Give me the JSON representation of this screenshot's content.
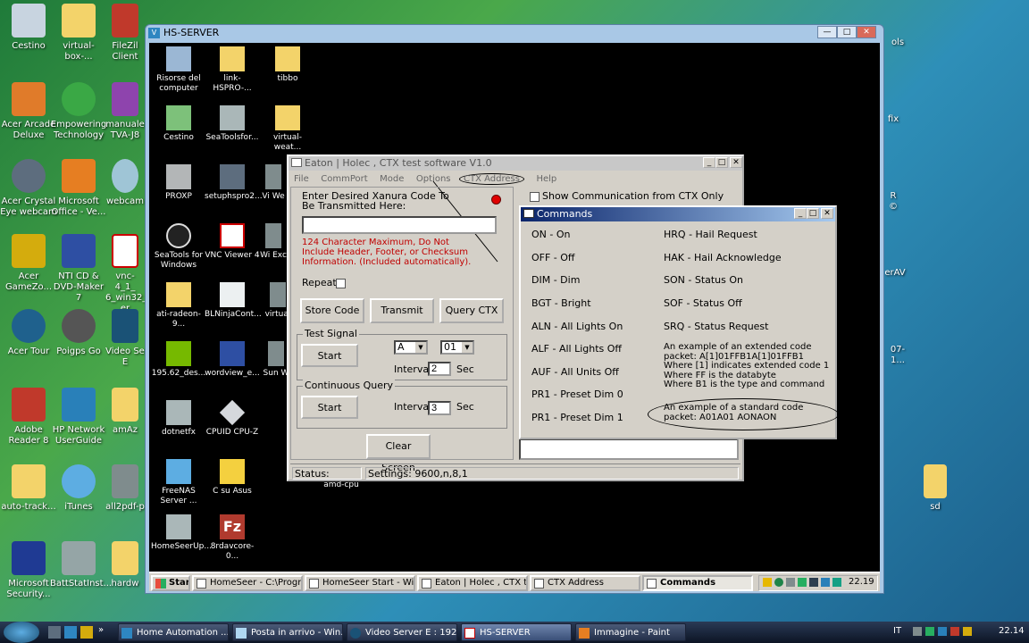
{
  "host_desktop_icons": [
    {
      "label": "Cestino",
      "x": 0
    },
    {
      "label": "virtual-box-...",
      "x": 1
    },
    {
      "label": "FileZil Client",
      "x": 2
    },
    {
      "label": "Acer Arcade Deluxe"
    },
    {
      "label": "Empowering Technology"
    },
    {
      "label": "manuale TVA-J8"
    },
    {
      "label": "Acer Crystal Eye webcam"
    },
    {
      "label": "Microsoft Office - Ve..."
    },
    {
      "label": "webcam"
    },
    {
      "label": "Acer GameZo..."
    },
    {
      "label": "NTI CD & DVD-Maker 7"
    },
    {
      "label": "vnc-4_1_ 6_win32_ er"
    },
    {
      "label": "Acer Tour"
    },
    {
      "label": "Poigps Go"
    },
    {
      "label": "Video Se E"
    },
    {
      "label": "Adobe Reader 8"
    },
    {
      "label": "HP Network UserGuide"
    },
    {
      "label": "amAz"
    },
    {
      "label": "auto-track..."
    },
    {
      "label": "iTunes"
    },
    {
      "label": "all2pdf-p"
    },
    {
      "label": "Microsoft Security..."
    },
    {
      "label": "BattStatInst..."
    },
    {
      "label": "hardw"
    }
  ],
  "host_right_labels": [
    "ols",
    "fix",
    "R ©",
    "erAV",
    "07-1...",
    "sd"
  ],
  "remote_window": {
    "title": "HS-SERVER",
    "icons": [
      "Risorse del computer",
      "link-HSPRO-...",
      "tibbo",
      "Cestino",
      "SeaToolsfor...",
      "virtual-weat...",
      "PROXP",
      "setuphspro2...",
      "Vi We",
      "SeaTools for Windows",
      "VNC Viewer 4",
      "Wi Exc",
      "ati-radeon-9...",
      "BLNinjaCont...",
      "virtual",
      "195.62_des...",
      "wordview_e...",
      "Sun W",
      "dotnetfx",
      "CPUID CPU-Z",
      "amd-cpu",
      "FreeNAS Server ...",
      "C su Asus",
      "HomeSeerUp...",
      "8rdavcore-0..."
    ]
  },
  "ctx_window": {
    "title": "Eaton | Holec , CTX test software V1.0",
    "menu": [
      "File",
      "CommPort",
      "Mode",
      "Options",
      "CTX Address",
      "Help"
    ],
    "prompt": "Enter Desired  Xanura Code To Be Transmitted Here:",
    "code_value": "",
    "warning": "124 Character Maximum, Do Not Include Header, Footer, or Checksum Information. (Included automatically).",
    "repeat_label": "Repeat",
    "store_code": "Store Code",
    "transmit": "Transmit",
    "query_ctx": "Query CTX",
    "test_signal_label": "Test Signal",
    "start": "Start",
    "house_code": "A",
    "unit_code": "01",
    "interval_label": "Interval",
    "interval_test": "2",
    "sec": "Sec",
    "continuous_query_label": "Continuous Query",
    "interval_query": "3",
    "clear_screen": "Clear Screen",
    "status_label": "Status:",
    "settings": "Settings: 9600,n,8,1",
    "show_comm": "Show Communication from CTX Only"
  },
  "commands_window": {
    "title": "Commands",
    "left": [
      "ON - On",
      "OFF - Off",
      "DIM -  Dim",
      "BGT - Bright",
      "ALN - All Lights On",
      "ALF - All Lights Off",
      "AUF - All Units Off",
      "PR1 - Preset Dim 0",
      "PR1 - Preset Dim 1"
    ],
    "right": [
      "HRQ - Hail Request",
      "HAK - Hail Acknowledge",
      "SON - Status On",
      "SOF - Status Off",
      "SRQ - Status Request"
    ],
    "extended_example": [
      "An example of an extended code",
      "packet: A[1]01FFB1A[1]01FFB1",
      "Where [1] indicates extended code 1",
      "Where FF is the databyte",
      "Where B1 is the type and command"
    ],
    "standard_example": [
      "An example of a standard code",
      "packet: A01A01 AONAON"
    ]
  },
  "remote_taskbar": {
    "start": "Start",
    "items": [
      "HomeSeer - C:\\Program...",
      "HomeSeer Start - Wind...",
      "Eaton | Holec , CTX test...",
      "CTX Address",
      "Commands"
    ],
    "clock": "22.19"
  },
  "host_taskbar": {
    "items": [
      "Home Automation ...",
      "Posta in arrivo - Win...",
      "Video Server E : 192....",
      "HS-SERVER",
      "Immagine - Paint"
    ],
    "lang": "IT",
    "clock": "22.14"
  }
}
